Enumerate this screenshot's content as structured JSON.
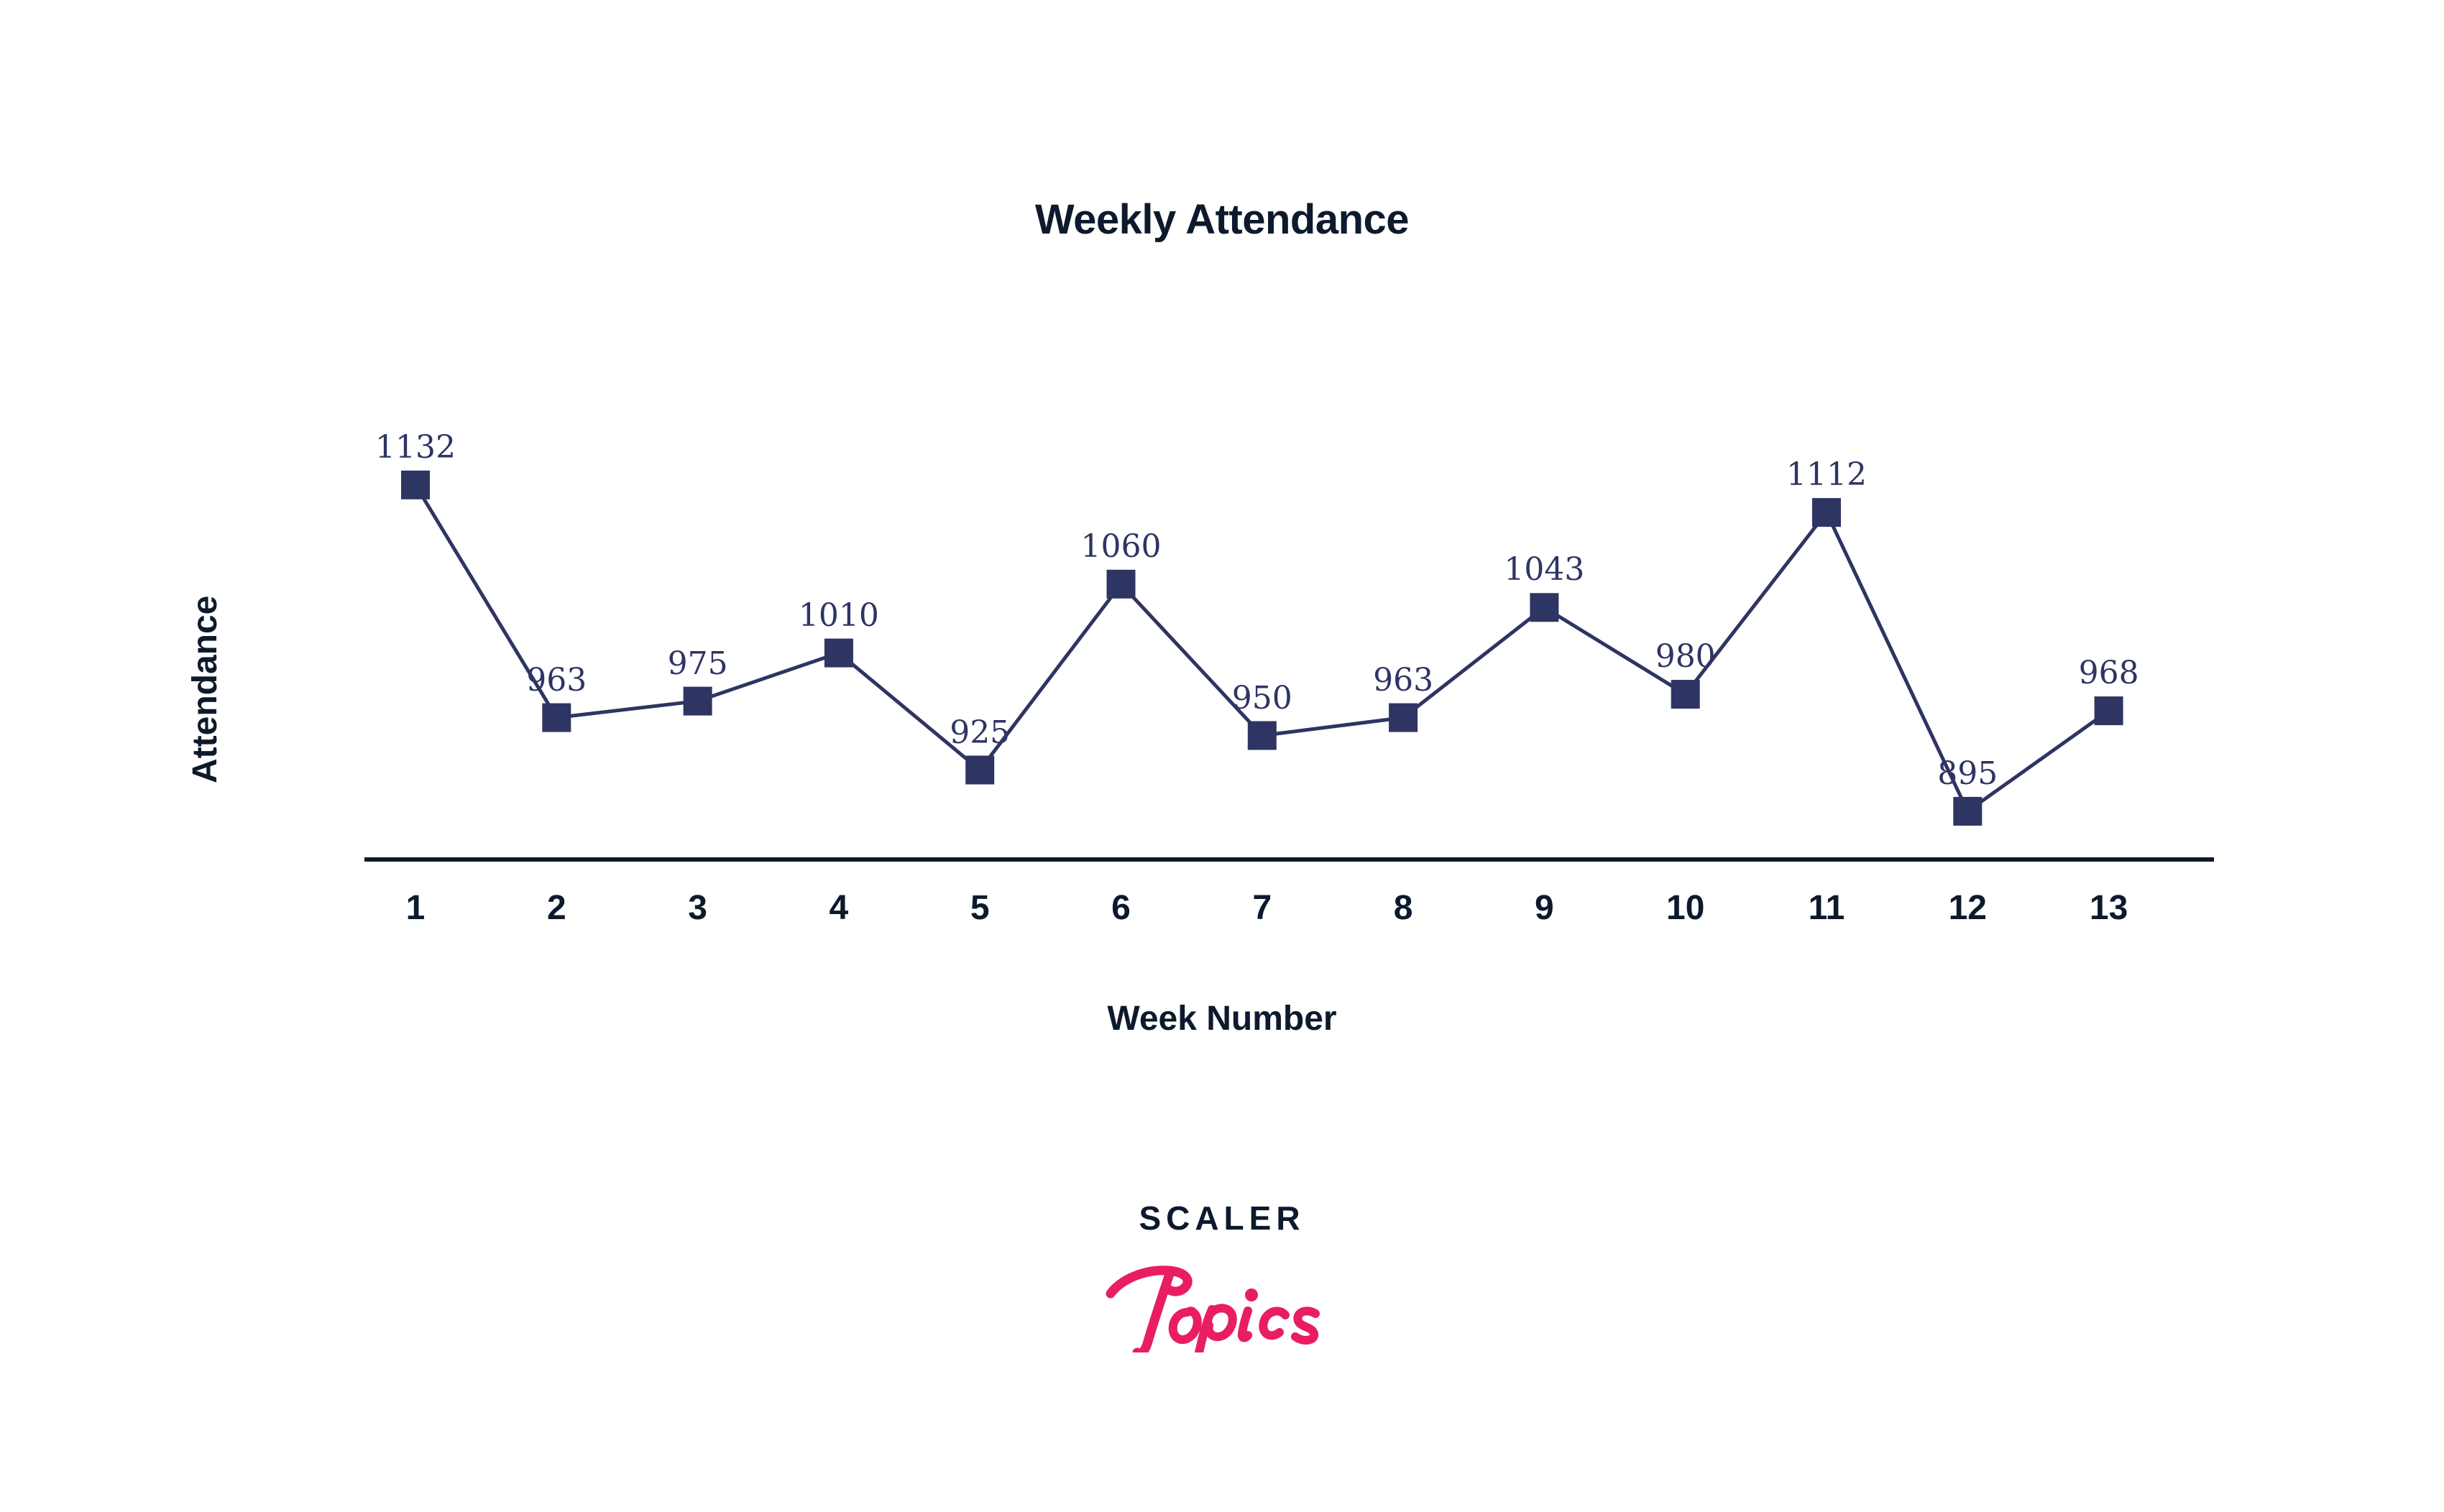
{
  "chart_data": {
    "type": "line",
    "title": "Weekly Attendance",
    "xlabel": "Week Number",
    "ylabel": "Attendance",
    "categories": [
      "1",
      "2",
      "3",
      "4",
      "5",
      "6",
      "7",
      "8",
      "9",
      "10",
      "11",
      "12",
      "13"
    ],
    "values": [
      1132,
      963,
      975,
      1010,
      925,
      1060,
      950,
      963,
      1043,
      980,
      1112,
      895,
      968
    ],
    "labels": [
      "1132",
      "963",
      "975",
      "1010",
      "925",
      "1060",
      "950",
      "963",
      "1043",
      "980",
      "1112",
      "895",
      "968"
    ],
    "series": [
      {
        "name": "Attendance",
        "values": [
          1132,
          963,
          975,
          1010,
          925,
          1060,
          950,
          963,
          1043,
          980,
          1112,
          895,
          968
        ]
      }
    ],
    "xlim": [
      0.5,
      13.5
    ],
    "ylim": [
      860,
      1170
    ],
    "grid": false,
    "legend": false,
    "legend_position": "none",
    "marker": "square",
    "show_data_labels": true,
    "y_axis_ticks_visible": false,
    "x_axis_line_visible": true
  },
  "style": {
    "background": "#ffffff",
    "series_color": "#2e3563",
    "axis_color": "#0d1a2d",
    "title_color": "#0d1a2d",
    "label_color": "#2e3563",
    "logo_text_color": "#0d1a2d",
    "logo_script_color": "#e91d62"
  },
  "logo": {
    "wordmark": "SCALER",
    "script": "Topics"
  }
}
